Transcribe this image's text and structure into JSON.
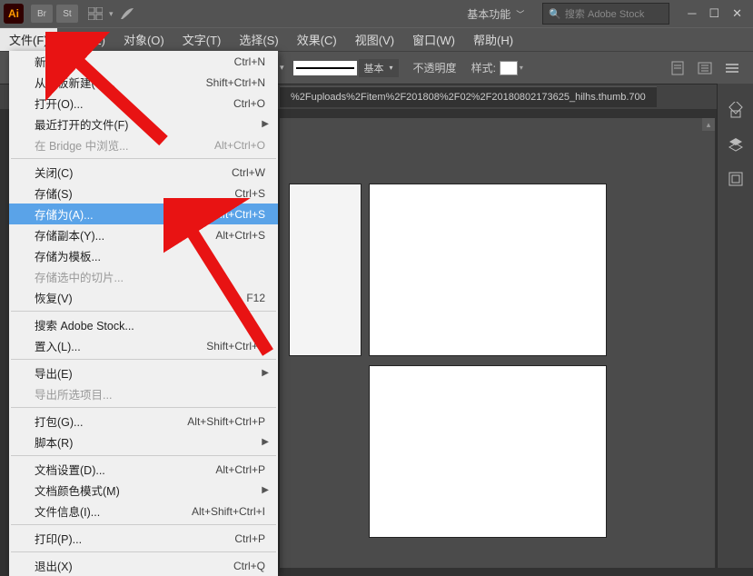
{
  "titlebar": {
    "logo": "Ai",
    "btn_br": "Br",
    "btn_st": "St",
    "workspace": "基本功能",
    "search_placeholder": "搜索 Adobe Stock"
  },
  "menubar": {
    "items": [
      "文件(F)",
      "编辑(E)",
      "对象(O)",
      "文字(T)",
      "选择(S)",
      "效果(C)",
      "视图(V)",
      "窗口(W)",
      "帮助(H)"
    ]
  },
  "controlbar": {
    "stroke_label": "基本",
    "opacity_label": "不透明度",
    "style_label": "样式:"
  },
  "tab": {
    "filename": "%2Fuploads%2Fitem%2F201808%2F02%2F20180802173625_hilhs.thumb.700"
  },
  "file_menu": {
    "items": [
      {
        "label": "新建(N)...",
        "shortcut": "Ctrl+N"
      },
      {
        "label": "从模板新建(T)...",
        "shortcut": "Shift+Ctrl+N"
      },
      {
        "label": "打开(O)...",
        "shortcut": "Ctrl+O"
      },
      {
        "label": "最近打开的文件(F)",
        "shortcut": "",
        "sub": true
      },
      {
        "label": "在 Bridge 中浏览...",
        "shortcut": "Alt+Ctrl+O",
        "disabled": true
      },
      {
        "sep": true
      },
      {
        "label": "关闭(C)",
        "shortcut": "Ctrl+W"
      },
      {
        "label": "存储(S)",
        "shortcut": "Ctrl+S"
      },
      {
        "label": "存储为(A)...",
        "shortcut": "Shift+Ctrl+S",
        "highlight": true
      },
      {
        "label": "存储副本(Y)...",
        "shortcut": "Alt+Ctrl+S"
      },
      {
        "label": "存储为模板...",
        "shortcut": ""
      },
      {
        "label": "存储选中的切片...",
        "shortcut": "",
        "disabled": true
      },
      {
        "label": "恢复(V)",
        "shortcut": "F12"
      },
      {
        "sep": true
      },
      {
        "label": "搜索 Adobe Stock...",
        "shortcut": ""
      },
      {
        "label": "置入(L)...",
        "shortcut": "Shift+Ctrl+P"
      },
      {
        "sep": true
      },
      {
        "label": "导出(E)",
        "shortcut": "",
        "sub": true
      },
      {
        "label": "导出所选项目...",
        "shortcut": "",
        "disabled": true
      },
      {
        "sep": true
      },
      {
        "label": "打包(G)...",
        "shortcut": "Alt+Shift+Ctrl+P"
      },
      {
        "label": "脚本(R)",
        "shortcut": "",
        "sub": true
      },
      {
        "sep": true
      },
      {
        "label": "文档设置(D)...",
        "shortcut": "Alt+Ctrl+P"
      },
      {
        "label": "文档颜色模式(M)",
        "shortcut": "",
        "sub": true
      },
      {
        "label": "文件信息(I)...",
        "shortcut": "Alt+Shift+Ctrl+I"
      },
      {
        "sep": true
      },
      {
        "label": "打印(P)...",
        "shortcut": "Ctrl+P"
      },
      {
        "sep": true
      },
      {
        "label": "退出(X)",
        "shortcut": "Ctrl+Q"
      }
    ]
  }
}
